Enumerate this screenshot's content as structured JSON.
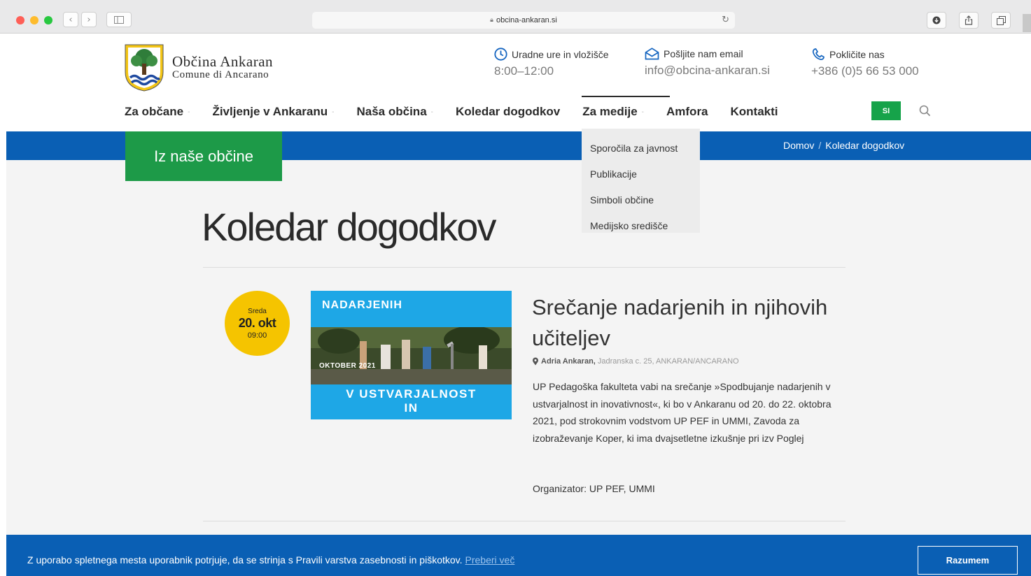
{
  "browser": {
    "url": "obcina-ankaran.si"
  },
  "site": {
    "name": "Občina Ankaran",
    "subname": "Comune di Ancarano"
  },
  "contacts": [
    {
      "label": "Uradne ure in vložišče",
      "value": "8:00–12:00",
      "icon": "clock-icon"
    },
    {
      "label": "Pošljite nam email",
      "value": "info@obcina-ankaran.si",
      "icon": "envelope-icon"
    },
    {
      "label": "Pokličite nas",
      "value": "+386 (0)5 66 53 000",
      "icon": "phone-icon"
    }
  ],
  "nav": {
    "items": [
      {
        "label": "Za občane",
        "dropdown": true
      },
      {
        "label": "Življenje v Ankaranu",
        "dropdown": true
      },
      {
        "label": "Naša občina",
        "dropdown": true
      },
      {
        "label": "Koledar dogodkov",
        "dropdown": false
      },
      {
        "label": "Za medije",
        "dropdown": true
      },
      {
        "label": "Amfora",
        "dropdown": false
      },
      {
        "label": "Kontakti",
        "dropdown": false
      }
    ],
    "active": "Za medije",
    "lang": "SI",
    "dropdown_marker": "-"
  },
  "dropdown": {
    "items": [
      "Sporočila za javnost",
      "Publikacije",
      "Simboli občine",
      "Medijsko središče"
    ]
  },
  "breadcrumb": {
    "home": "Domov",
    "sep": "/",
    "current": "Koledar dogodkov"
  },
  "section_label": "Iz naše občine",
  "page_title": "Koledar dogodkov",
  "event": {
    "day": "Sreda",
    "date": "20. okt",
    "time": "09:00",
    "image_text_top": "NADARJENIH",
    "image_text_date": "OKTOBER 2021",
    "image_text_bottom": "V USTVARJALNOST",
    "image_text_bottom2": "IN",
    "title": "Srečanje nadarjenih in njihovih učiteljev",
    "location_name": "Adria Ankaran,",
    "location_address": "Jadranska c. 25, ANKARAN/ANCARANO",
    "description": "UP Pedagoška fakulteta vabi na srečanje »Spodbujanje nadarjenih v ustvarjalnost in inovativnost«, ki bo v Ankaranu od 20. do 22. oktobra 2021, pod strokovnim vodstvom UP PEF in UMMI, Zavoda za izobraževanje Koper, ki ima dvajsetletne izkušnje pri izv Poglej",
    "organizer": "Organizator: UP PEF, UMMI"
  },
  "cookie": {
    "text": "Z uporabo spletnega mesta uporabnik potrjuje, da se strinja s Pravili varstva zasebnosti in piškotkov.",
    "link": "Preberi več",
    "button": "Razumem"
  },
  "colors": {
    "blue": "#0a5fb4",
    "green": "#1d9a48",
    "yellow": "#f5c400"
  }
}
